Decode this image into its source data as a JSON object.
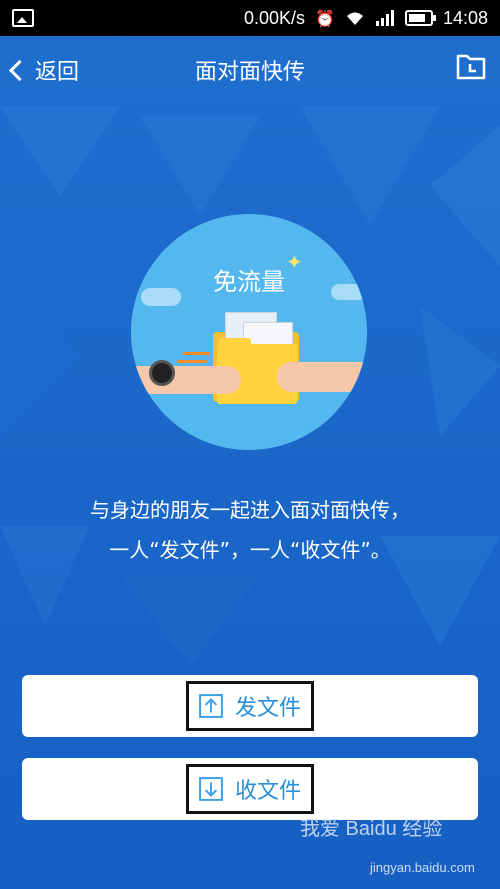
{
  "status_bar": {
    "speed": "0.00K/s",
    "time": "14:08",
    "icons": [
      "image-icon",
      "alarm-icon",
      "wifi-icon",
      "signal-icon",
      "battery-icon"
    ]
  },
  "nav": {
    "back_label": "返回",
    "title": "面对面快传",
    "right_icon": "folder-clock-icon"
  },
  "hero": {
    "badge_text": "免流量"
  },
  "description": {
    "line1": "与身边的朋友一起进入面对面快传，",
    "line2": "一人“发文件”，一人“收文件”。"
  },
  "actions": {
    "send_label": "发文件",
    "receive_label": "收文件"
  },
  "watermark": {
    "brand": "我爱 Baidu 经验",
    "url": "jingyan.baidu.com"
  },
  "colors": {
    "background": "#1a66c8",
    "circle": "#54b8ef",
    "accent": "#2a8fd8"
  }
}
